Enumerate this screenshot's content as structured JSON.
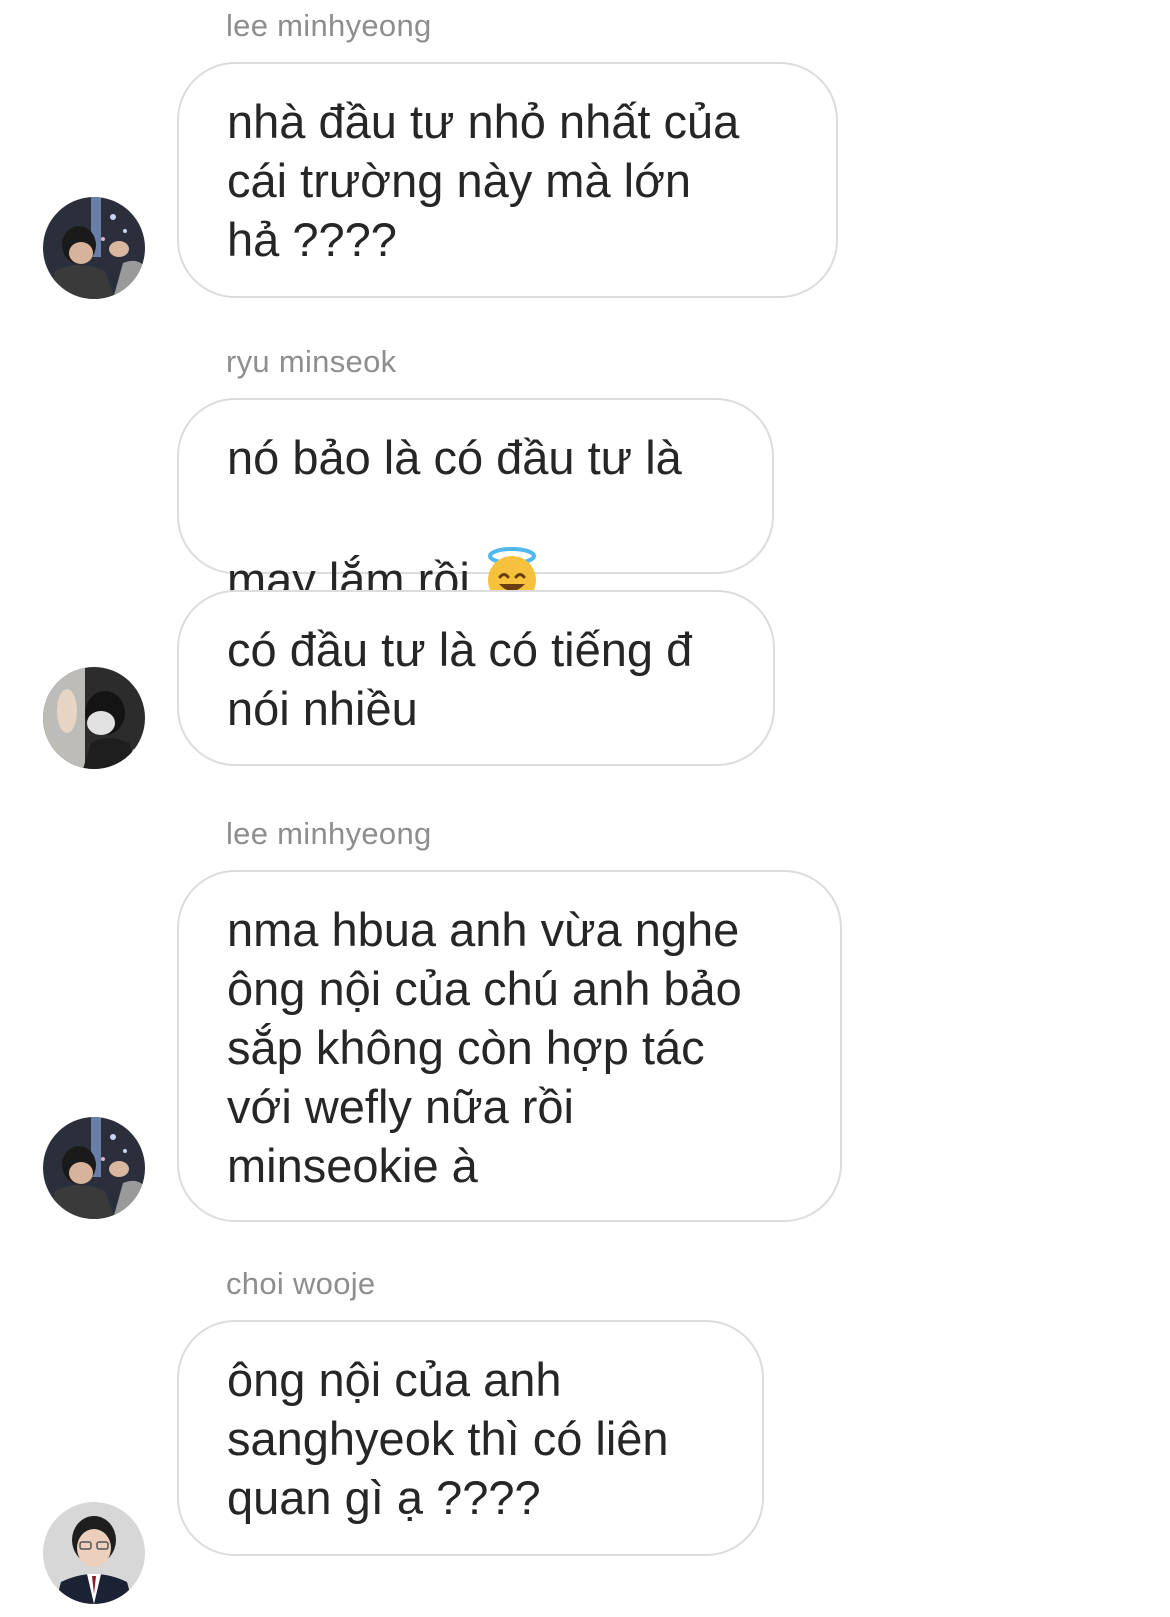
{
  "thread": {
    "messages": [
      {
        "sender": "lee minhyeong",
        "text": "nhà đầu tư nhỏ nhất của\ncái trường này mà lớn\nhả ????"
      },
      {
        "sender": "ryu minseok",
        "text": "nó bảo là có đầu tư là\nmay lắm rồi",
        "emoji": "smiling-face-with-halo-icon"
      },
      {
        "sender": "",
        "text": "có đầu tư là có tiếng đ\nnói nhiều"
      },
      {
        "sender": "lee minhyeong",
        "text": "nma hbua anh vừa nghe\nông nội của chú anh bảo\nsắp không còn hợp tác\nvới wefly nữa rồi\nminseokie à"
      },
      {
        "sender": "choi wooje",
        "text": "ông nội của anh\nsanghyeok thì có liên\nquan gì ạ ????"
      }
    ]
  },
  "colors": {
    "sender_text": "#8e8e8e",
    "message_text": "#262626",
    "bubble_border": "#dcdcdc",
    "background": "#ffffff"
  }
}
